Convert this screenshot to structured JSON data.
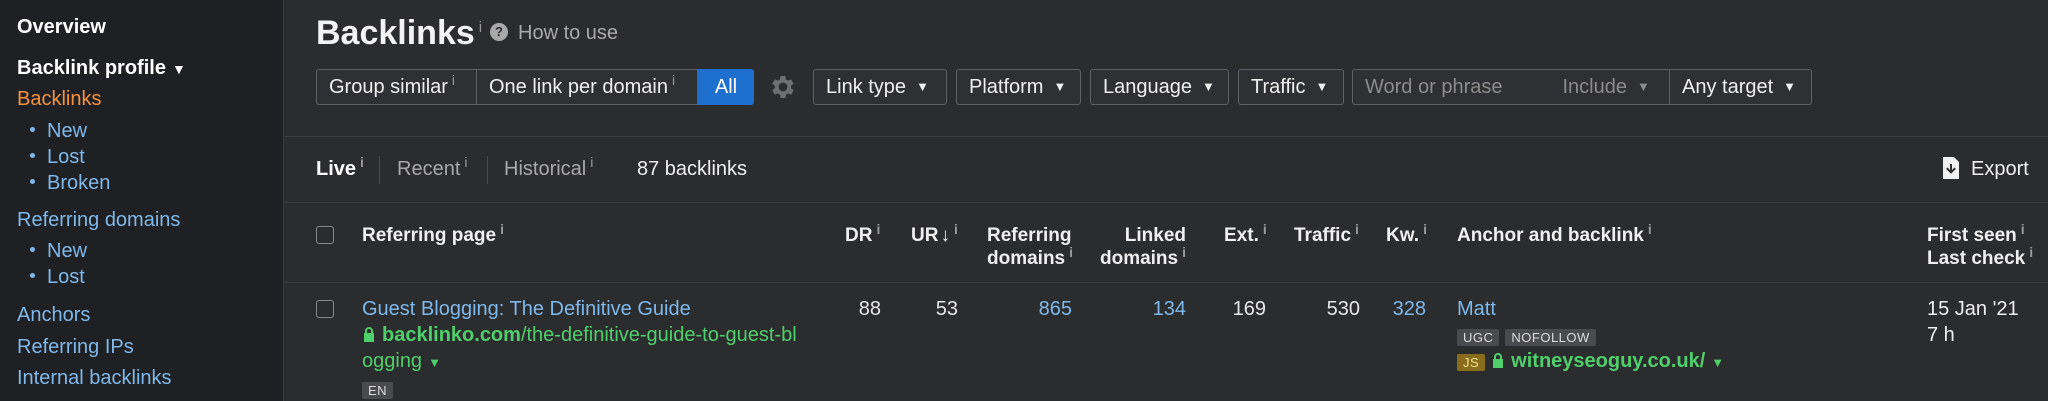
{
  "sidebar": {
    "overview": "Overview",
    "backlink_profile": "Backlink profile",
    "backlinks": "Backlinks",
    "backlinks_sub": [
      "New",
      "Lost",
      "Broken"
    ],
    "referring_domains": "Referring domains",
    "referring_sub": [
      "New",
      "Lost"
    ],
    "anchors": "Anchors",
    "referring_ips": "Referring IPs",
    "internal_backlinks": "Internal backlinks"
  },
  "header": {
    "title": "Backlinks",
    "info_mark": "i",
    "how_to_use": "How to use"
  },
  "filters": {
    "group_similar": "Group similar",
    "one_link_per_domain": "One link per domain",
    "all": "All",
    "link_type": "Link type",
    "platform": "Platform",
    "language": "Language",
    "traffic": "Traffic",
    "search_placeholder": "Word or phrase",
    "include": "Include",
    "any_target": "Any target"
  },
  "tabs": {
    "live": "Live",
    "recent": "Recent",
    "historical": "Historical",
    "count": "87 backlinks",
    "export": "Export"
  },
  "columns": {
    "referring_page": "Referring page",
    "dr": "DR",
    "ur": "UR",
    "ur_sort": "↓",
    "referring_domains_1": "Referring",
    "referring_domains_2": "domains",
    "linked_domains_1": "Linked",
    "linked_domains_2": "domains",
    "ext": "Ext.",
    "traffic": "Traffic",
    "kw": "Kw.",
    "anchor": "Anchor and backlink",
    "first_seen": "First seen",
    "last_check": "Last check"
  },
  "row": {
    "title": "Guest Blogging: The Definitive Guide",
    "domain": "backlinko.com",
    "path_1": "/the-definitive-guide-to-guest-bl",
    "path_2": "ogging",
    "lang": "EN",
    "dr": "88",
    "ur": "53",
    "referring_domains": "865",
    "linked_domains": "134",
    "ext": "169",
    "traffic": "530",
    "kw": "328",
    "anchor": "Matt",
    "tag_ugc": "UGC",
    "tag_nofollow": "NOFOLLOW",
    "tag_js": "JS",
    "target": "witneyseoguy.co.uk/",
    "first_seen": "15 Jan '21",
    "last_check": "7 h"
  },
  "colors": {
    "accent": "#1f6fcf",
    "link": "#7fb8ea",
    "active_nav": "#f5923e",
    "url_green": "#4fcf6b"
  },
  "icons": [
    "question-circle-icon",
    "gear-icon",
    "caret-down-icon",
    "export-icon",
    "lock-icon"
  ]
}
